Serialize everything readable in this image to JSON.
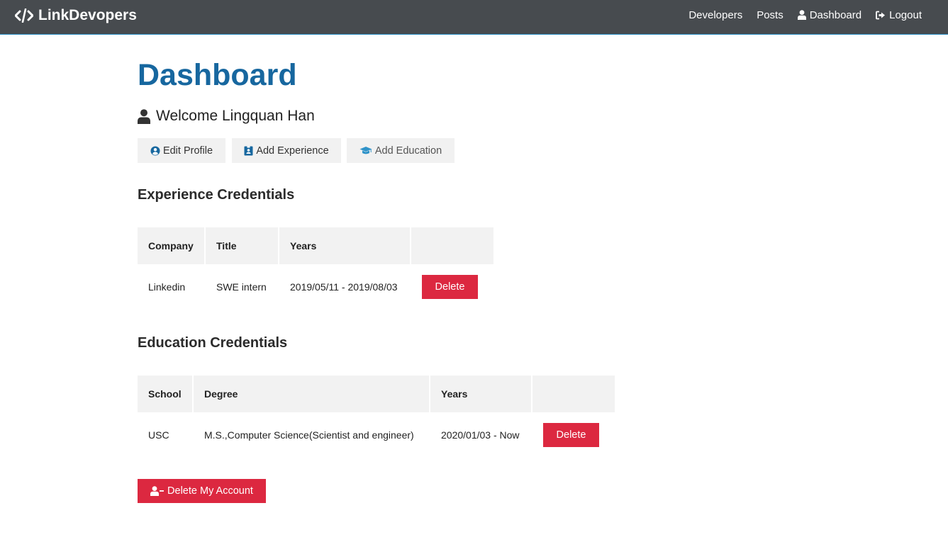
{
  "navbar": {
    "brand_text": "LinkDevopers",
    "brand_icon": "code-icon",
    "links": [
      {
        "label": "Developers"
      },
      {
        "label": "Posts"
      },
      {
        "label": "Dashboard",
        "icon": "user-icon"
      },
      {
        "label": "Logout",
        "icon": "sign-out-icon"
      }
    ]
  },
  "page": {
    "title": "Dashboard",
    "welcome": "Welcome Lingquan Han"
  },
  "actions": {
    "edit_profile": "Edit Profile",
    "add_experience": "Add Experience",
    "add_education": "Add Education"
  },
  "experience": {
    "heading": "Experience Credentials",
    "columns": [
      "Company",
      "Title",
      "Years",
      ""
    ],
    "rows": [
      {
        "company": "Linkedin",
        "title": "SWE intern",
        "years": "2019/05/11 - 2019/08/03",
        "delete_label": "Delete"
      }
    ]
  },
  "education": {
    "heading": "Education Credentials",
    "columns": [
      "School",
      "Degree",
      "Years",
      ""
    ],
    "rows": [
      {
        "school": "USC",
        "degree": "M.S.,Computer Science(Scientist and engineer)",
        "years": "2020/01/03 - Now",
        "delete_label": "Delete"
      }
    ]
  },
  "account": {
    "delete_label": "Delete My Account"
  },
  "colors": {
    "navbar_bg": "#474b4f",
    "title": "#17679f",
    "danger": "#dc2840",
    "light_button": "#f1f1f1",
    "icon_blue": "#17679f"
  }
}
